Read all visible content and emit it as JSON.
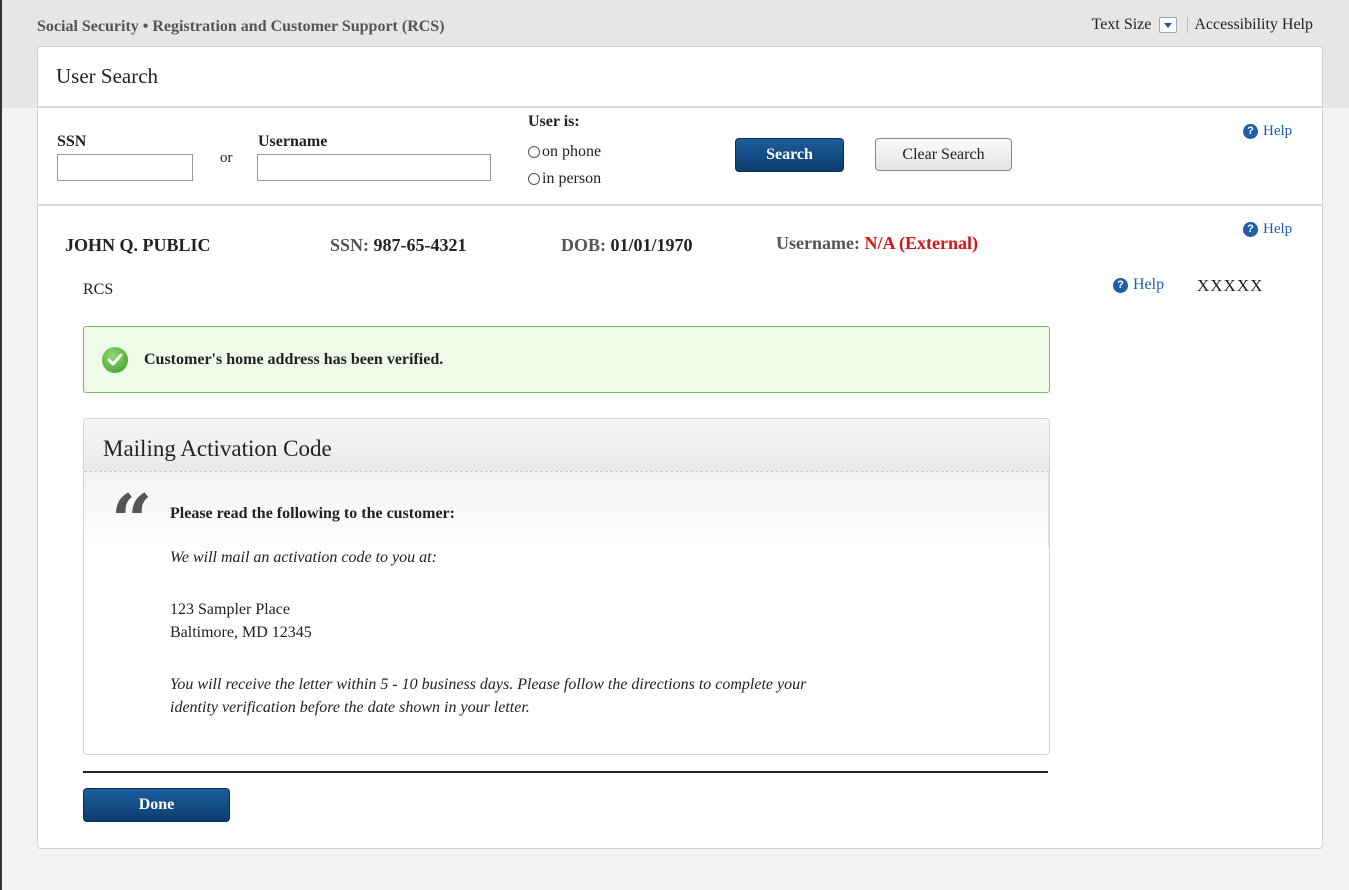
{
  "header": {
    "brand": "Social Security • Registration and Customer Support (RCS)",
    "text_size_label": "Text Size",
    "accessibility_help": "Accessibility Help"
  },
  "card": {
    "title": "User Search"
  },
  "search": {
    "ssn_label": "SSN",
    "or_label": "or",
    "username_label": "Username",
    "ssn_value": "",
    "username_value": "",
    "user_is_label": "User is:",
    "radio_on_phone": "on phone",
    "radio_in_person": "in person",
    "search_button": "Search",
    "clear_button": "Clear Search",
    "help_label": "Help"
  },
  "customer": {
    "name": "JOHN Q. PUBLIC",
    "ssn_label": "SSN:",
    "ssn_value": "987-65-4321",
    "dob_label": "DOB:",
    "dob_value": "01/01/1970",
    "username_label": "Username:",
    "username_value": "N/A (External)",
    "help_label": "Help",
    "section_label": "RCS",
    "section_help_label": "Help",
    "section_code": "XXXXX"
  },
  "success_message": "Customer's home address has been verified.",
  "panel": {
    "title": "Mailing Activation Code",
    "quote_mark": "“",
    "instruction": "Please read the following to the customer:",
    "line1": "We will mail an activation code to you at:",
    "address_line1": "123 Sampler Place",
    "address_line2": "Baltimore, MD 12345",
    "line2a": "You will receive the letter within 5 - 10 business days. Please follow the directions to complete your",
    "line2b": "identity verification before the date shown in your letter."
  },
  "done_button": "Done",
  "colors": {
    "primary": "#0c3d6e",
    "link": "#1f5ea8",
    "alert_red": "#d11111",
    "success_bg": "#eefbe8",
    "success_border": "#6cbf5a"
  }
}
